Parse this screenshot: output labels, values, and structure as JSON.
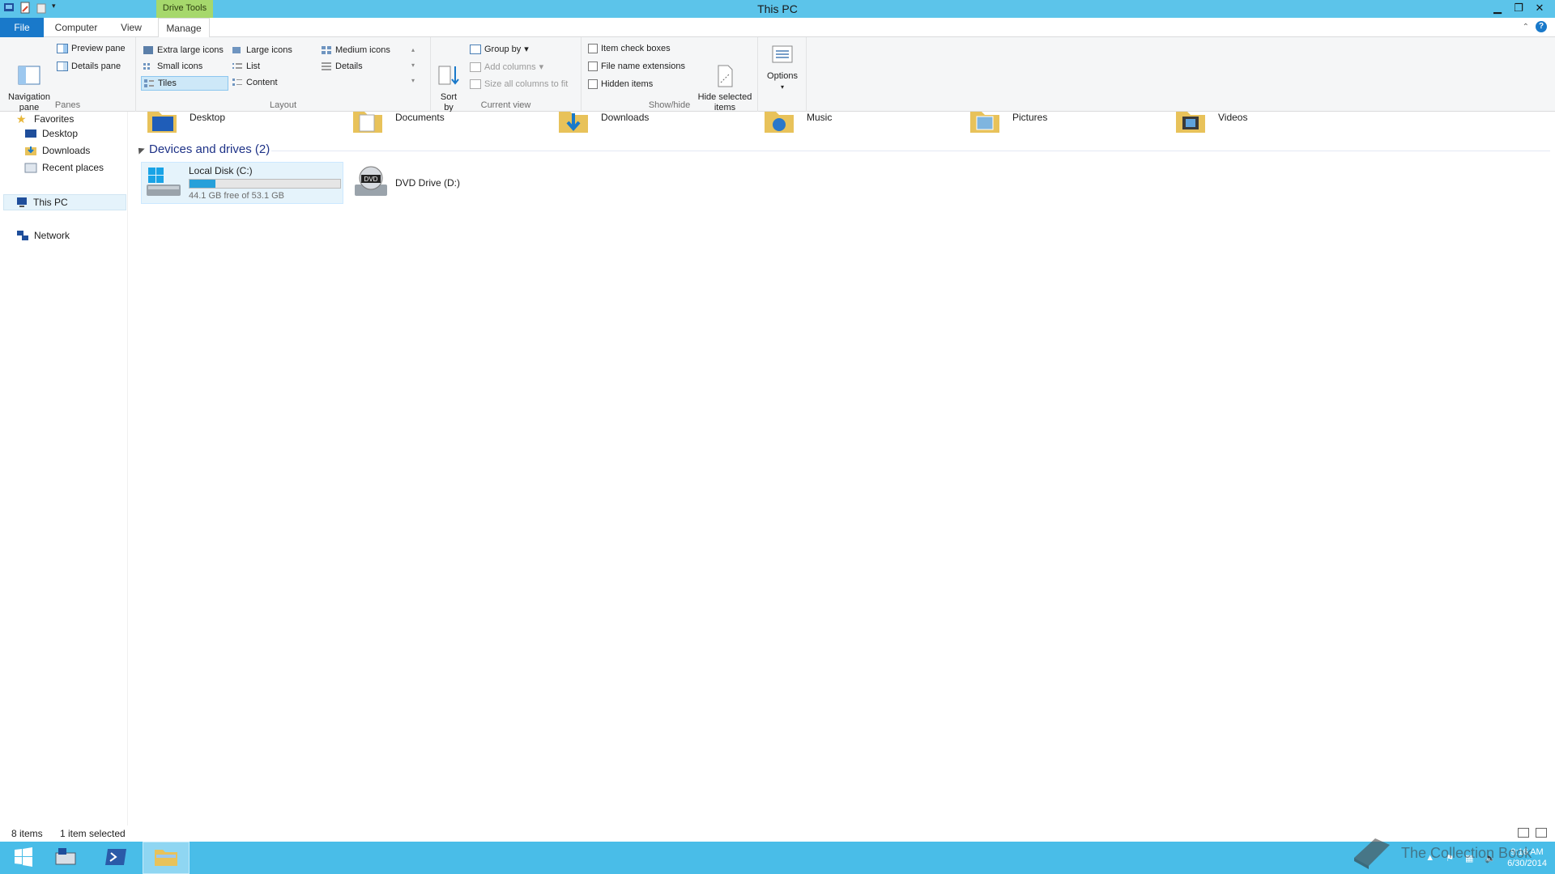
{
  "window": {
    "title": "This PC",
    "context_tab": "Drive Tools",
    "buttons": [
      "minimize",
      "restore",
      "close"
    ]
  },
  "tabs": [
    {
      "label": "File"
    },
    {
      "label": "Computer"
    },
    {
      "label": "View"
    },
    {
      "label": "Manage"
    }
  ],
  "ribbon": {
    "panes": {
      "label": "Panes",
      "navigation_pane": "Navigation\npane",
      "preview_pane": "Preview pane",
      "details_pane": "Details pane"
    },
    "layout": {
      "label": "Layout",
      "extra_large_icons": "Extra large icons",
      "large_icons": "Large icons",
      "medium_icons": "Medium icons",
      "small_icons": "Small icons",
      "list": "List",
      "details": "Details",
      "tiles": "Tiles",
      "content": "Content"
    },
    "current_view": {
      "label": "Current view",
      "sort_by": "Sort\nby",
      "group_by": "Group by",
      "add_columns": "Add columns",
      "size_all_columns": "Size all columns to fit"
    },
    "show_hide": {
      "label": "Show/hide",
      "item_check_boxes": "Item check boxes",
      "file_name_extensions": "File name extensions",
      "hidden_items": "Hidden items",
      "hide_selected_items": "Hide selected\nitems"
    },
    "options": "Options"
  },
  "nav": {
    "favorites": "Favorites",
    "desktop": "Desktop",
    "downloads": "Downloads",
    "recent_places": "Recent places",
    "this_pc": "This PC",
    "network": "Network"
  },
  "folders": [
    "Desktop",
    "Documents",
    "Downloads",
    "Music",
    "Pictures",
    "Videos"
  ],
  "devices": {
    "header": "Devices and drives (2)",
    "local_disk": {
      "name": "Local Disk (C:)",
      "free": "44.1 GB free of 53.1 GB",
      "used_fraction": 0.17
    },
    "dvd": {
      "name": "DVD Drive (D:)",
      "badge": "DVD"
    }
  },
  "status": {
    "items": "8 items",
    "selected": "1 item selected"
  },
  "taskbar": {
    "time": "9:16 AM",
    "date": "6/30/2014"
  },
  "watermark": "The Collection Book",
  "colors": {
    "titlebar": "#5cc4ea",
    "file_tab": "#1979ca",
    "context_tab": "#a6d86c",
    "taskbar": "#49bde8",
    "drive_bar": "#26a0da"
  }
}
